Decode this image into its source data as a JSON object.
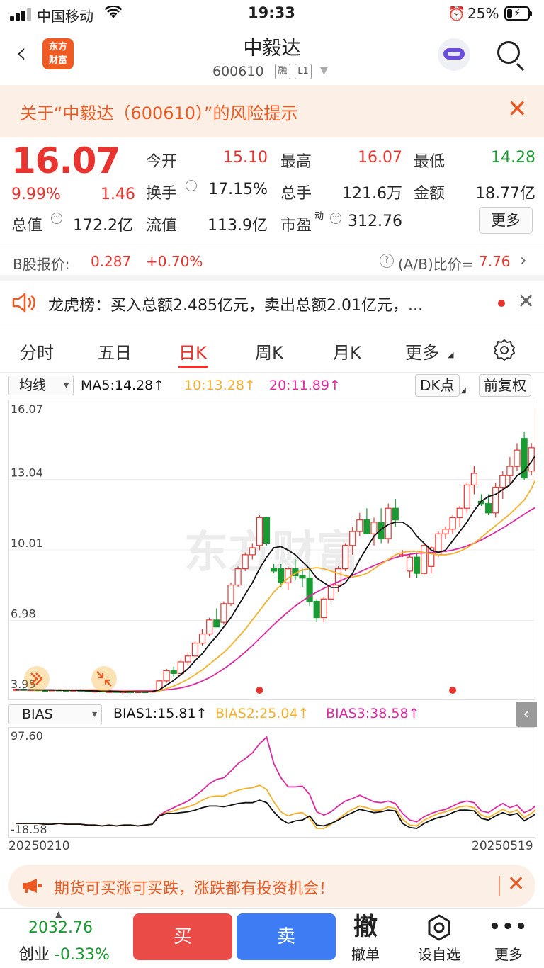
{
  "status_bar": {
    "carrier": "中国移动",
    "time": "19:33",
    "battery": "25%"
  },
  "nav": {
    "logo_line1": "东方",
    "logo_line2": "财富",
    "title": "中毅达",
    "code": "600610",
    "badge1": "融",
    "badge2": "L1"
  },
  "risk_banner": {
    "text": "关于“中毅达（600610）”的风险提示"
  },
  "quote": {
    "price": "16.07",
    "change_pct": "9.99%",
    "change": "1.46",
    "open_label": "今开",
    "open": "15.10",
    "high_label": "最高",
    "high": "16.07",
    "low_label": "最低",
    "low": "14.28",
    "turnover_label": "换手",
    "turnover": "17.15%",
    "volume_label": "总手",
    "volume": "121.6万",
    "amount_label": "金额",
    "amount": "18.77亿",
    "mktcap_label": "总值",
    "mktcap": "172.2亿",
    "float_label": "流值",
    "float": "113.9亿",
    "pe_label": "市盈",
    "pe_sup": "动",
    "pe": "312.76",
    "more_label": "更多"
  },
  "b_share": {
    "label": "B股报价:",
    "price": "0.287",
    "pct": "+0.70%",
    "ratio_label": "(A/B)比价=",
    "ratio": "7.76"
  },
  "dragon_tiger": {
    "text": "龙虎榜：买入总额2.485亿元，卖出总额2.01亿元，..."
  },
  "tabs": [
    "分时",
    "五日",
    "日K",
    "周K",
    "月K",
    "更多"
  ],
  "ma_row": {
    "selector": "均线",
    "ma5": "MA5:14.28↑",
    "ma10": "10:13.28↑",
    "ma20": "20:11.89↑",
    "dk_label": "DK点",
    "adjust_label": "前复权"
  },
  "bias_row": {
    "selector": "BIAS",
    "bias1": "BIAS1:15.81↑",
    "bias2": "BIAS2:25.04↑",
    "bias3": "BIAS3:38.58↑"
  },
  "colors": {
    "up": "#e8332e",
    "down": "#1a9a32",
    "ma5": "#111111",
    "ma10": "#f5b02e",
    "ma20": "#de2aa0",
    "accent": "#ea5a22"
  },
  "chart_data": [
    {
      "type": "candlestick",
      "watermark": "东方财富",
      "y_ticks": [
        "16.07",
        "13.04",
        "10.01",
        "6.98",
        "3.95"
      ],
      "ylim": [
        3.95,
        16.07
      ],
      "candles": [
        [
          4.0,
          4.05,
          3.95,
          4.02
        ],
        [
          4.02,
          4.06,
          3.97,
          3.99
        ],
        [
          3.99,
          4.03,
          3.95,
          4.01
        ],
        [
          4.01,
          4.04,
          3.96,
          3.98
        ],
        [
          3.98,
          4.02,
          3.95,
          3.97
        ],
        [
          3.97,
          4.03,
          3.95,
          4.0
        ],
        [
          4.0,
          4.05,
          3.97,
          3.98
        ],
        [
          3.98,
          4.02,
          3.94,
          3.96
        ],
        [
          3.96,
          4.01,
          3.93,
          3.99
        ],
        [
          3.99,
          4.03,
          3.95,
          3.97
        ],
        [
          3.97,
          4.0,
          3.9,
          3.92
        ],
        [
          3.92,
          3.97,
          3.88,
          3.95
        ],
        [
          3.95,
          3.98,
          3.89,
          3.91
        ],
        [
          3.91,
          3.96,
          3.87,
          3.93
        ],
        [
          3.93,
          3.97,
          3.88,
          3.9
        ],
        [
          3.9,
          3.95,
          3.86,
          3.92
        ],
        [
          3.92,
          3.96,
          3.87,
          3.89
        ],
        [
          3.89,
          3.94,
          3.86,
          3.92
        ],
        [
          3.92,
          3.96,
          3.88,
          3.9
        ],
        [
          3.9,
          4.0,
          3.88,
          3.98
        ],
        [
          3.98,
          4.4,
          3.96,
          4.38
        ],
        [
          4.38,
          4.9,
          4.3,
          4.82
        ],
        [
          4.82,
          5.0,
          4.55,
          4.7
        ],
        [
          4.7,
          5.3,
          4.6,
          5.2
        ],
        [
          5.2,
          5.6,
          5.05,
          5.45
        ],
        [
          5.45,
          6.1,
          5.4,
          6.0
        ],
        [
          6.0,
          6.6,
          5.9,
          6.4
        ],
        [
          6.4,
          7.1,
          6.3,
          7.0
        ],
        [
          7.0,
          7.5,
          6.8,
          6.7
        ],
        [
          6.9,
          7.8,
          6.8,
          7.7
        ],
        [
          7.7,
          8.6,
          7.6,
          8.5
        ],
        [
          8.5,
          9.3,
          8.4,
          9.2
        ],
        [
          9.2,
          9.9,
          9.1,
          9.8
        ],
        [
          9.8,
          10.3,
          9.6,
          10.1
        ],
        [
          10.2,
          11.5,
          10.0,
          11.4
        ],
        [
          11.4,
          11.4,
          10.2,
          10.3
        ],
        [
          9.2,
          9.4,
          9.0,
          9.1
        ],
        [
          9.2,
          9.4,
          8.4,
          8.6
        ],
        [
          8.6,
          9.3,
          8.3,
          9.2
        ],
        [
          9.2,
          9.6,
          8.7,
          8.9
        ],
        [
          8.9,
          9.2,
          8.4,
          8.8
        ],
        [
          8.8,
          9.2,
          7.6,
          7.8
        ],
        [
          7.8,
          7.9,
          6.9,
          7.1
        ],
        [
          7.1,
          8.0,
          6.9,
          7.9
        ],
        [
          7.9,
          8.6,
          7.8,
          8.5
        ],
        [
          8.5,
          9.3,
          8.2,
          9.2
        ],
        [
          9.2,
          10.3,
          9.1,
          10.2
        ],
        [
          10.2,
          11.0,
          9.8,
          10.8
        ],
        [
          10.8,
          11.6,
          10.6,
          11.3
        ],
        [
          11.3,
          11.8,
          10.9,
          10.7
        ],
        [
          10.7,
          11.4,
          10.2,
          11.2
        ],
        [
          11.2,
          11.8,
          10.3,
          10.5
        ],
        [
          10.5,
          12.0,
          10.3,
          11.8
        ],
        [
          11.8,
          12.2,
          11.0,
          11.3
        ],
        [
          9.8,
          10.0,
          9.7,
          9.8
        ],
        [
          9.1,
          9.8,
          8.8,
          9.7
        ],
        [
          9.7,
          9.9,
          8.8,
          9.0
        ],
        [
          9.0,
          10.3,
          8.9,
          10.2
        ],
        [
          9.3,
          10.2,
          9.0,
          10.1
        ],
        [
          9.8,
          10.8,
          9.7,
          10.7
        ],
        [
          10.7,
          11.0,
          10.5,
          10.9
        ],
        [
          10.9,
          11.5,
          10.7,
          11.4
        ],
        [
          11.4,
          11.9,
          11.0,
          11.8
        ],
        [
          11.8,
          12.9,
          11.6,
          12.8
        ],
        [
          12.8,
          13.6,
          12.4,
          13.3
        ],
        [
          12.1,
          12.4,
          11.9,
          12.0
        ],
        [
          12.0,
          12.4,
          11.5,
          11.6
        ],
        [
          11.6,
          12.9,
          11.4,
          12.7
        ],
        [
          12.7,
          13.4,
          12.2,
          13.2
        ],
        [
          13.2,
          14.0,
          12.8,
          13.6
        ],
        [
          13.6,
          14.6,
          13.4,
          14.3
        ],
        [
          14.8,
          15.1,
          13.0,
          13.1
        ],
        [
          13.4,
          14.6,
          13.2,
          14.4
        ],
        [
          14.4,
          16.07,
          14.28,
          16.07
        ]
      ],
      "ma5": [
        4.0,
        4.0,
        4.0,
        3.99,
        3.99,
        3.99,
        3.98,
        3.98,
        3.98,
        3.97,
        3.96,
        3.95,
        3.94,
        3.94,
        3.93,
        3.92,
        3.92,
        3.91,
        3.91,
        3.92,
        4.0,
        4.2,
        4.4,
        4.65,
        4.9,
        5.25,
        5.55,
        5.95,
        6.3,
        6.7,
        7.1,
        7.6,
        8.1,
        8.6,
        9.2,
        9.7,
        10.1,
        10.15,
        10.0,
        9.8,
        9.5,
        9.2,
        8.8,
        8.6,
        8.4,
        8.4,
        8.6,
        9.0,
        9.6,
        10.1,
        10.6,
        10.9,
        11.1,
        11.2,
        11.2,
        11.0,
        10.6,
        10.3,
        10.0,
        9.9,
        10.0,
        10.4,
        10.8,
        11.2,
        11.7,
        12.1,
        12.3,
        12.4,
        12.6,
        12.8,
        13.2,
        13.4,
        13.8,
        14.28
      ],
      "ma10": [
        4.0,
        4.0,
        4.0,
        4.0,
        3.99,
        3.99,
        3.99,
        3.99,
        3.98,
        3.98,
        3.98,
        3.97,
        3.97,
        3.96,
        3.95,
        3.95,
        3.94,
        3.93,
        3.93,
        3.93,
        3.95,
        4.05,
        4.15,
        4.3,
        4.45,
        4.65,
        4.85,
        5.1,
        5.35,
        5.6,
        5.9,
        6.25,
        6.6,
        7.0,
        7.4,
        7.8,
        8.2,
        8.5,
        8.8,
        9.0,
        9.15,
        9.2,
        9.25,
        9.2,
        9.1,
        9.0,
        8.9,
        8.85,
        8.9,
        9.0,
        9.2,
        9.4,
        9.6,
        9.8,
        9.9,
        9.95,
        9.95,
        9.9,
        9.85,
        9.8,
        9.8,
        9.85,
        9.95,
        10.1,
        10.3,
        10.55,
        10.8,
        11.05,
        11.3,
        11.55,
        11.85,
        12.15,
        12.65,
        13.28
      ],
      "ma20": [
        4.0,
        4.0,
        4.0,
        4.0,
        4.0,
        4.0,
        3.99,
        3.99,
        3.99,
        3.99,
        3.99,
        3.99,
        3.98,
        3.98,
        3.98,
        3.98,
        3.97,
        3.97,
        3.97,
        3.97,
        3.97,
        4.0,
        4.03,
        4.08,
        4.15,
        4.25,
        4.38,
        4.52,
        4.7,
        4.9,
        5.12,
        5.36,
        5.62,
        5.9,
        6.2,
        6.5,
        6.8,
        7.08,
        7.35,
        7.6,
        7.82,
        8.02,
        8.2,
        8.36,
        8.5,
        8.64,
        8.78,
        8.92,
        9.06,
        9.2,
        9.33,
        9.46,
        9.58,
        9.68,
        9.76,
        9.82,
        9.86,
        9.88,
        9.9,
        9.92,
        9.95,
        10.0,
        10.08,
        10.18,
        10.3,
        10.44,
        10.6,
        10.77,
        10.95,
        11.14,
        11.34,
        11.54,
        11.74,
        11.89
      ],
      "markers": [
        {
          "kind": "double-chevron-icon"
        },
        {
          "kind": "collapse-arrows-icon"
        }
      ],
      "signal_dots": [
        34,
        61
      ]
    },
    {
      "type": "line",
      "y_ticks": [
        "97.60",
        "-18.58"
      ],
      "ylim": [
        -18.58,
        97.6
      ],
      "series": [
        {
          "name": "BIAS1",
          "values": [
            -10,
            -10,
            -10,
            -10,
            -11,
            -11,
            -10,
            -11,
            -11,
            -11,
            -12,
            -12,
            -13,
            -12,
            -13,
            -12,
            -12,
            -13,
            -12,
            -11,
            -1,
            2,
            2,
            3,
            4,
            6,
            9,
            11,
            11,
            10,
            12,
            14,
            15,
            15,
            18,
            15,
            4,
            -5,
            -10,
            -7,
            -6,
            -1,
            -12,
            -13,
            -10,
            -6,
            -1,
            3,
            7,
            5,
            3,
            4,
            6,
            5,
            -10,
            -15,
            -16,
            -10,
            -6,
            -3,
            -1,
            3,
            6,
            6,
            5,
            -4,
            -6,
            -1,
            3,
            0,
            2,
            -7,
            -2,
            4
          ]
        },
        {
          "name": "BIAS2",
          "values": [
            -10,
            -10,
            -10,
            -10,
            -11,
            -11,
            -10,
            -11,
            -11,
            -11,
            -12,
            -12,
            -13,
            -12,
            -13,
            -12,
            -12,
            -13,
            -12,
            -11,
            -1,
            3,
            5,
            8,
            10,
            13,
            18,
            22,
            23,
            23,
            27,
            30,
            32,
            33,
            36,
            31,
            16,
            4,
            -1,
            2,
            3,
            -4,
            -16,
            -16,
            -11,
            -5,
            2,
            7,
            11,
            9,
            6,
            6,
            10,
            8,
            -5,
            -12,
            -13,
            -6,
            -2,
            2,
            4,
            7,
            10,
            11,
            9,
            0,
            -3,
            2,
            7,
            3,
            6,
            -3,
            2,
            10
          ]
        },
        {
          "name": "BIAS3",
          "values": [
            -10,
            -10,
            -10,
            -10,
            -11,
            -11,
            -10,
            -11,
            -11,
            -11,
            -12,
            -12,
            -13,
            -12,
            -13,
            -12,
            -12,
            -13,
            -12,
            -11,
            0,
            5,
            9,
            13,
            17,
            23,
            30,
            38,
            43,
            45,
            53,
            62,
            68,
            75,
            86,
            94,
            62,
            45,
            34,
            34,
            35,
            25,
            4,
            0,
            4,
            11,
            17,
            20,
            24,
            20,
            16,
            15,
            17,
            14,
            2,
            -6,
            -8,
            -2,
            2,
            5,
            7,
            11,
            15,
            17,
            15,
            5,
            3,
            9,
            14,
            9,
            12,
            3,
            7,
            14
          ]
        }
      ],
      "x_start": "20250210",
      "x_end": "20250519"
    }
  ],
  "promo": {
    "text": "期货可买涨可买跌，涨跌都有投资机会！"
  },
  "bottom": {
    "index_value": "2032.76",
    "index_name": "创业",
    "index_pct": "-0.33%",
    "buy_label": "买",
    "sell_label": "卖",
    "withdraw_icon": "撤",
    "withdraw_label": "撤单",
    "watch_label": "设自选",
    "more_label": "更多"
  }
}
